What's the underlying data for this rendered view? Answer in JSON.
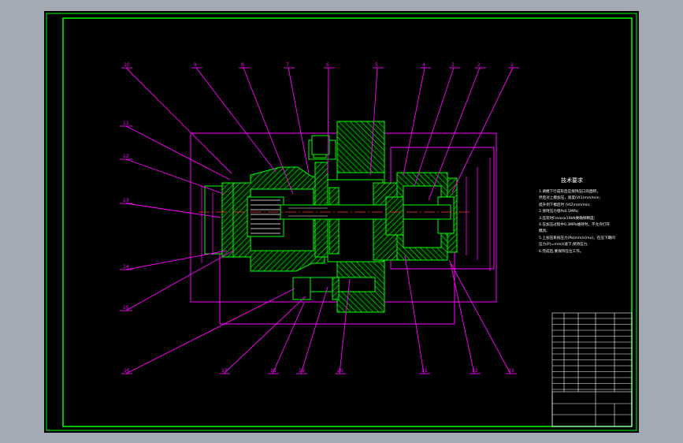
{
  "drawing": {
    "balloons_top": [
      "10",
      "9",
      "8",
      "7",
      "6",
      "5",
      "4",
      "3",
      "2",
      "1"
    ],
    "balloons_left": [
      "11",
      "12",
      "13",
      "14",
      "15"
    ],
    "balloons_bottom": [
      "16",
      "17",
      "18",
      "19",
      "20",
      "21",
      "22",
      "23"
    ],
    "tech_title": "技术要求",
    "tech_lines": [
      "1.调模下行成形后应保持压口的面积，",
      "  然后对上模加压，速度(Vt1)mm/min;",
      "  提升到下模后时      (Vt2)mm/min;",
      "2.保持压力值Ps0.5MPa;",
      "3.压装时Fmax≥10kN要确保精度;",
      "4.在加压过程中0.3MPa维持时，不允许打开",
      "  模具;",
      "5.上加压系统压力(Pa)mm/s(mv)，在压下期间",
      "  压力(P)=mm/s速下,保持压力,",
      "6.完成后,要保持在位工作。"
    ],
    "colors": {
      "frame": "#00ff00",
      "part": "#00ff00",
      "leader": "#ff00ff",
      "dimension": "#ff00ff",
      "text": "#ffffff",
      "centerline": "#ff3333"
    }
  }
}
